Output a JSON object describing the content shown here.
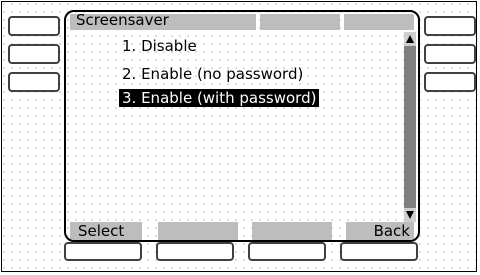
{
  "screen": {
    "title": "Screensaver"
  },
  "menu": {
    "items": [
      {
        "label": "1. Disable"
      },
      {
        "label": "2. Enable (no password)"
      },
      {
        "label": "3. Enable (with password)"
      }
    ],
    "selected_index": 2
  },
  "softkeys": {
    "left_label": "Select",
    "right_label": "Back"
  },
  "colors": {
    "selection_bg": "#000000",
    "selection_fg": "#ffffff",
    "tab_gray": "#bdbdbd",
    "scroll_thumb": "#808080"
  },
  "icons": [
    "scroll-up-arrow-icon",
    "scroll-down-arrow-icon"
  ]
}
